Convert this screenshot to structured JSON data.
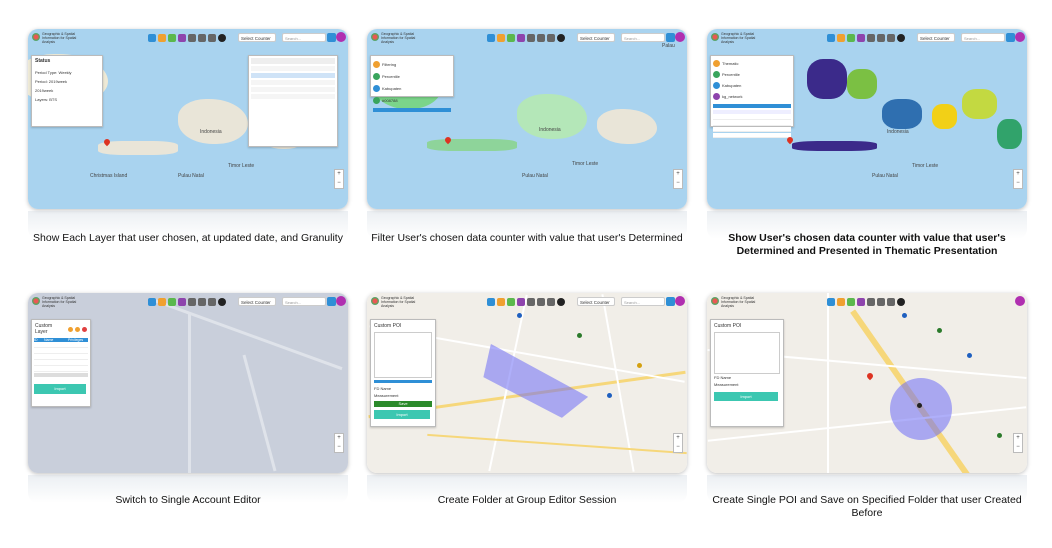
{
  "app": {
    "search_placeholder": "Search...",
    "dropdown_value": "Select Counter",
    "logo_text": "Geographic & Spatial Information for Spatial Analysis",
    "palette": {
      "toolbar": [
        "#2f8fd6",
        "#f0a030",
        "#5bb84d",
        "#8e44ad",
        "#555555",
        "#555555",
        "#555555",
        "#555555",
        "#555555",
        "#222222"
      ]
    }
  },
  "cards": [
    {
      "caption": "Show Each Layer that user chosen, at updated date, and Granulity",
      "panel_title": "Status",
      "fields": [
        {
          "label": "Period Type",
          "value": "Weekly"
        },
        {
          "label": "Period",
          "value": "2019week"
        },
        {
          "label": "",
          "value": "2019week"
        },
        {
          "label": "Layers",
          "value": "BTS"
        }
      ],
      "map_labels": [
        "Indonesia",
        "Timor Leste",
        "Pulau Natal",
        "Christmas Island"
      ]
    },
    {
      "caption": "Filter User's chosen data counter with value that user's Determined",
      "panel": {
        "items": [
          "Filtering",
          "Percentile",
          "Kabupaten",
          "#008788"
        ]
      },
      "map_labels": [
        "Indonesia",
        "Timor Leste",
        "Pulau Natal",
        "Palau"
      ]
    },
    {
      "caption": "Show User's chosen data counter with value that user's Determined and Presented in Thematic Presentation",
      "panel": {
        "items": [
          "Thematic",
          "Percentile",
          "Kabupaten",
          "kg_network"
        ]
      },
      "map_labels": [
        "Indonesia",
        "Timor Leste",
        "Pulau Natal"
      ]
    },
    {
      "caption": "Switch to Single Account Editor",
      "panel_title": "Custom Layer",
      "table_header": [
        "ID",
        "Name",
        "Privileges"
      ],
      "button": "Import"
    },
    {
      "caption": "Create Folder at Group Editor Session",
      "panel_title": "Custom POI",
      "button_save": "Save",
      "button": "Import",
      "fields": [
        "FD Name",
        "Measurement"
      ]
    },
    {
      "caption": "Create Single POI and Save on Specified Folder that user Created Before",
      "panel_title": "Custom POI",
      "button": "Import",
      "fields": [
        "FD Name",
        "Measurement"
      ]
    }
  ]
}
